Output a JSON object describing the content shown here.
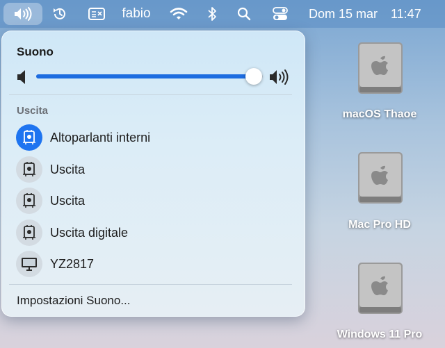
{
  "menubar": {
    "user": "fabio",
    "date": "Dom 15 mar",
    "time": "11:47",
    "icons": [
      "speaker-icon",
      "history-icon",
      "keyboard-icon",
      "wifi-icon",
      "bluetooth-icon",
      "search-icon",
      "control-center-icon"
    ]
  },
  "sound_panel": {
    "title": "Suono",
    "volume": 0.96,
    "output_section_label": "Uscita",
    "outputs": [
      {
        "label": "Altoparlanti interni",
        "selected": true,
        "icon": "speaker-device-icon"
      },
      {
        "label": "Uscita",
        "selected": false,
        "icon": "speaker-device-icon"
      },
      {
        "label": "Uscita",
        "selected": false,
        "icon": "speaker-device-icon"
      },
      {
        "label": "Uscita digitale",
        "selected": false,
        "icon": "speaker-device-icon"
      },
      {
        "label": "YZ2817",
        "selected": false,
        "icon": "display-icon"
      }
    ],
    "settings_label": "Impostazioni Suono..."
  },
  "desktop": {
    "drives": [
      {
        "label": "macOS Thaoe"
      },
      {
        "label": "Mac Pro HD"
      },
      {
        "label": "Windows 11 Pro"
      }
    ]
  },
  "colors": {
    "accent": "#1e74f0",
    "slider_fill": "#1d6ce0"
  }
}
